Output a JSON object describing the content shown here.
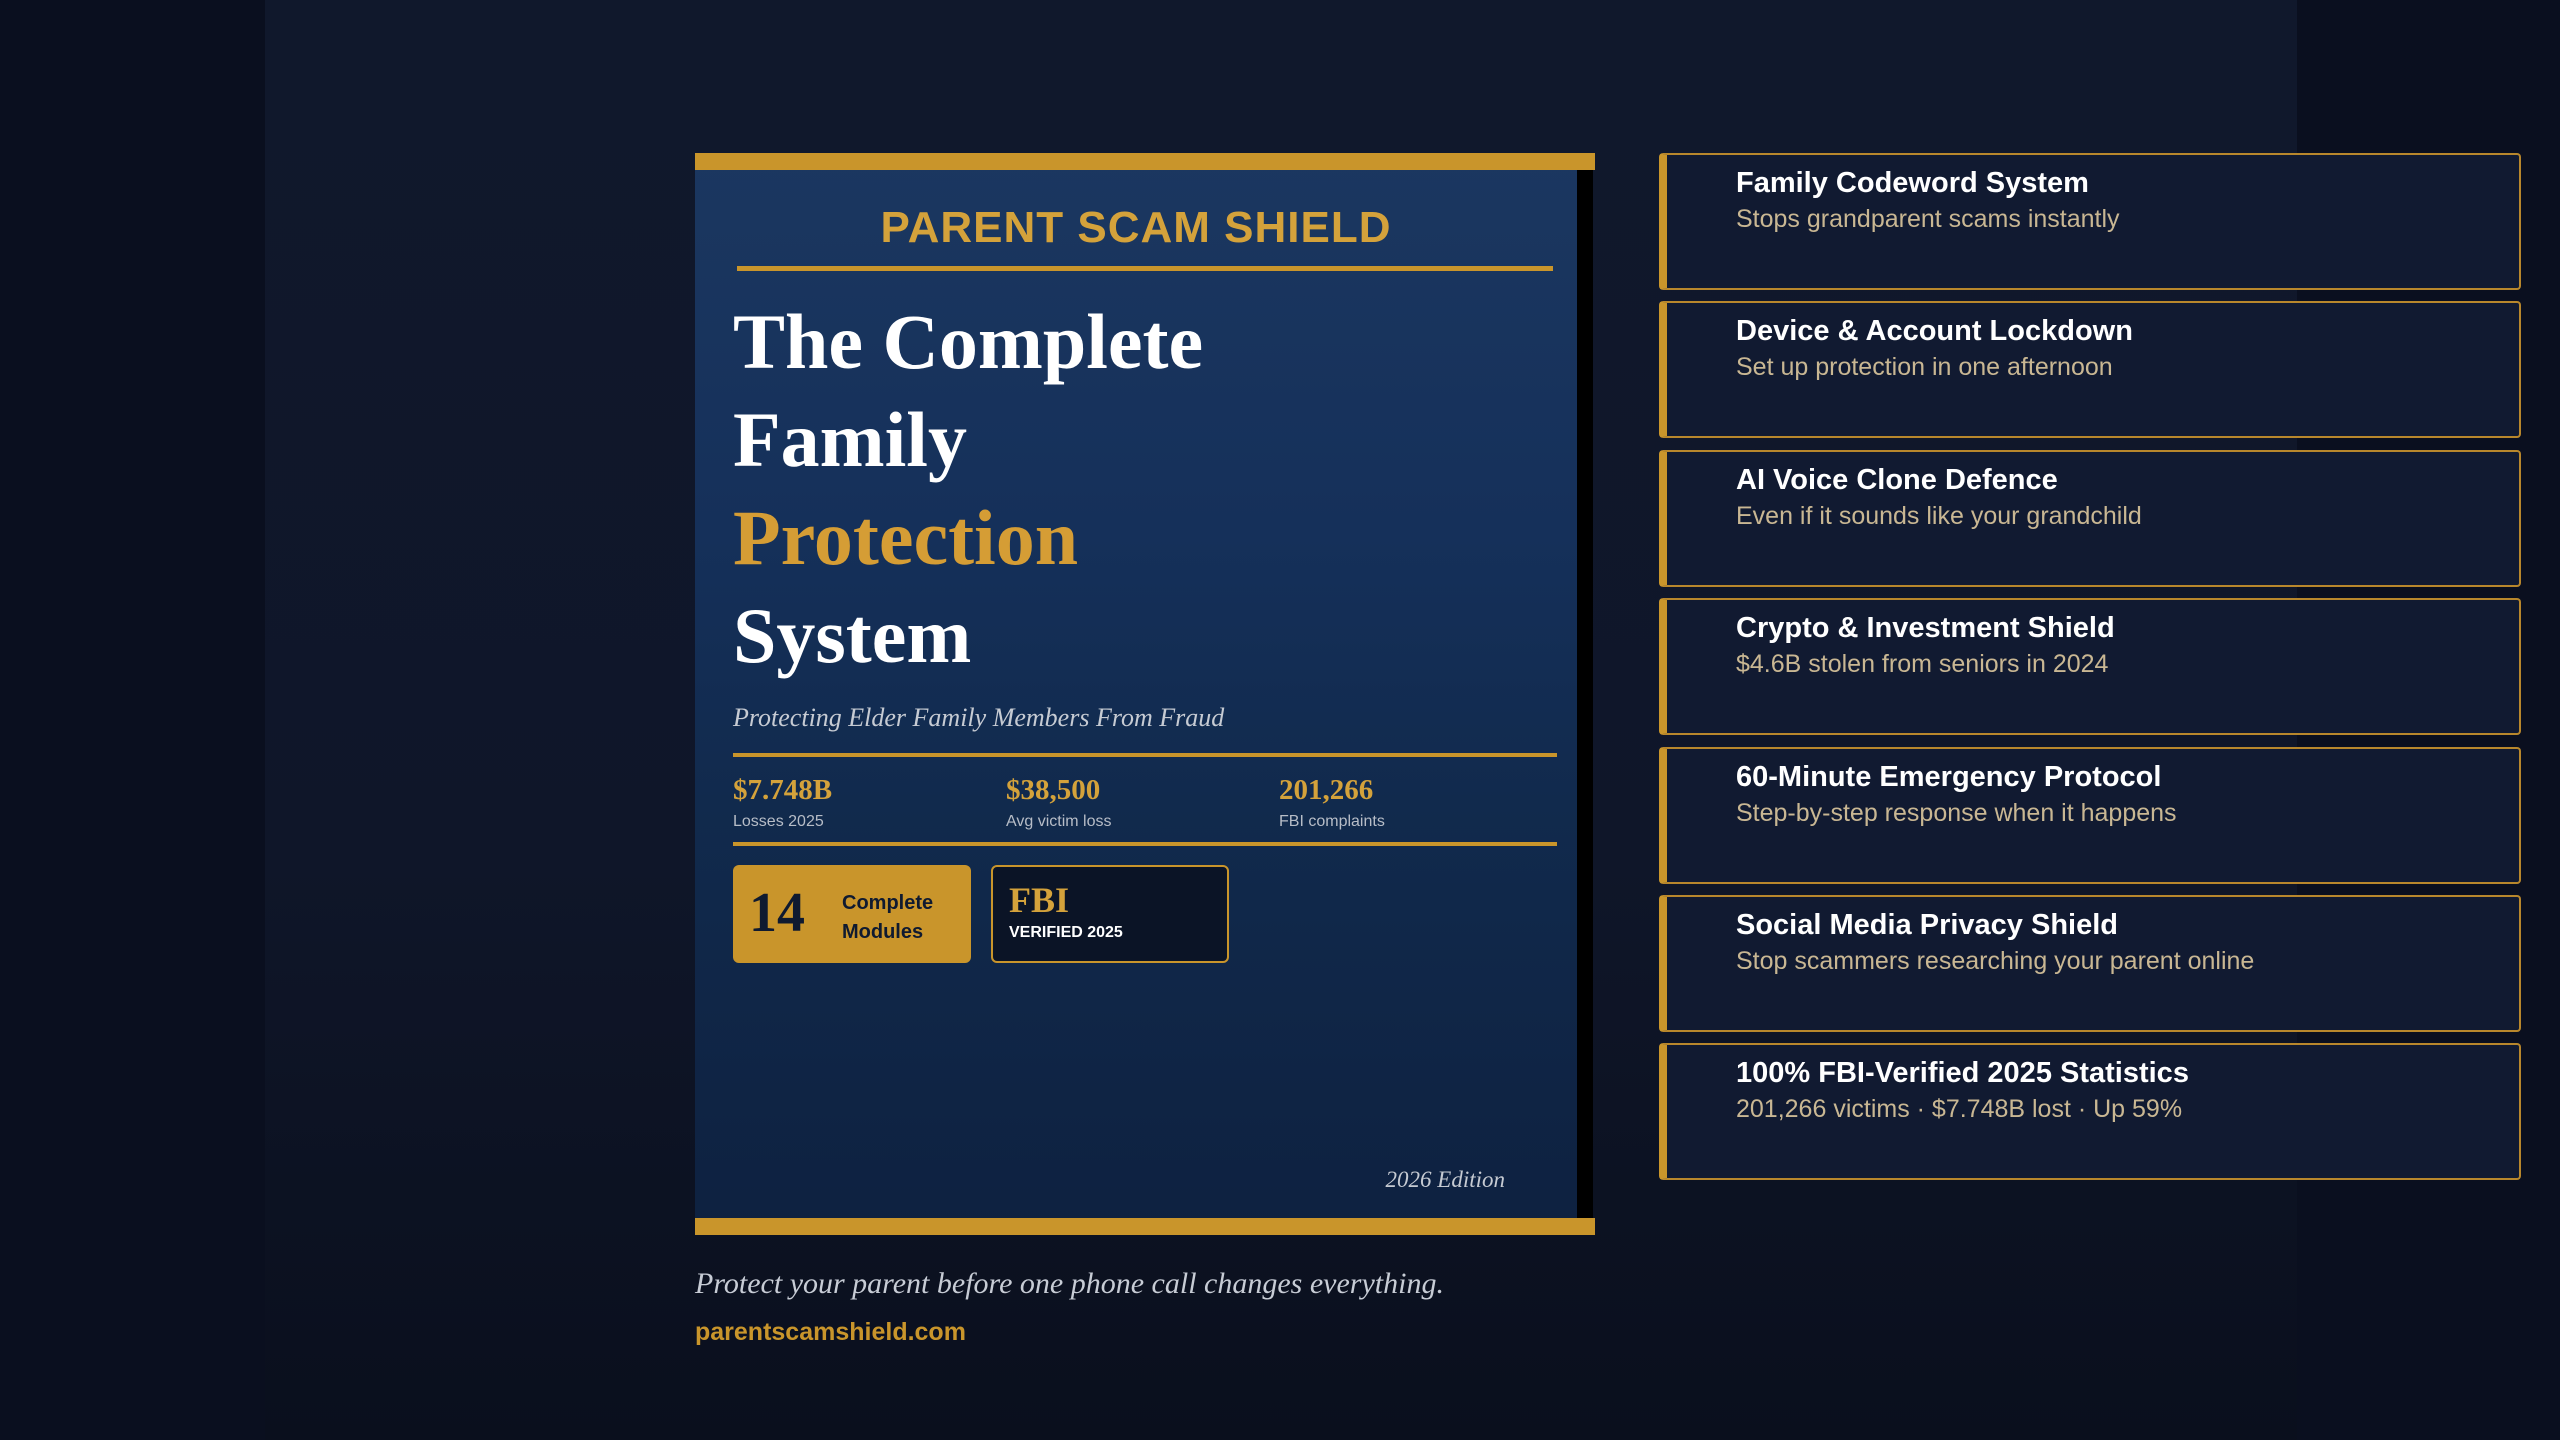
{
  "cover": {
    "brand": "PARENT SCAM SHIELD",
    "title_lines": [
      "The Complete",
      "Family",
      "Protection",
      "System"
    ],
    "subtitle": "Protecting Elder Family Members From Fraud",
    "stats": [
      {
        "value": "$7.748B",
        "label": "Losses 2025"
      },
      {
        "value": "$38,500",
        "label": "Avg victim loss"
      },
      {
        "value": "201,266",
        "label": "FBI complaints"
      }
    ],
    "modules_badge": {
      "number": "14",
      "label": "Complete Modules"
    },
    "fbi_badge": {
      "title": "FBI",
      "subtitle": "VERIFIED 2025"
    },
    "edition": "2026 Edition"
  },
  "tagline": "Protect your parent before one phone call changes everything.",
  "site_link": "parentscamshield.com",
  "features": [
    {
      "title": "Family Codeword System",
      "subtitle": "Stops grandparent scams instantly"
    },
    {
      "title": "Device & Account Lockdown",
      "subtitle": "Set up protection in one afternoon"
    },
    {
      "title": "AI Voice Clone Defence",
      "subtitle": "Even if it sounds like your grandchild"
    },
    {
      "title": "Crypto & Investment Shield",
      "subtitle": "$4.6B stolen from seniors in 2024"
    },
    {
      "title": "60-Minute Emergency Protocol",
      "subtitle": "Step-by-step response when it happens"
    },
    {
      "title": "Social Media Privacy Shield",
      "subtitle": "Stop scammers researching your parent online"
    },
    {
      "title": "100% FBI-Verified 2025 Statistics",
      "subtitle": "201,266 victims · $7.748B lost · Up 59%"
    }
  ],
  "colors": {
    "gold": "#c9952b",
    "navy": "#15305a",
    "background": "#0a0f1f"
  }
}
